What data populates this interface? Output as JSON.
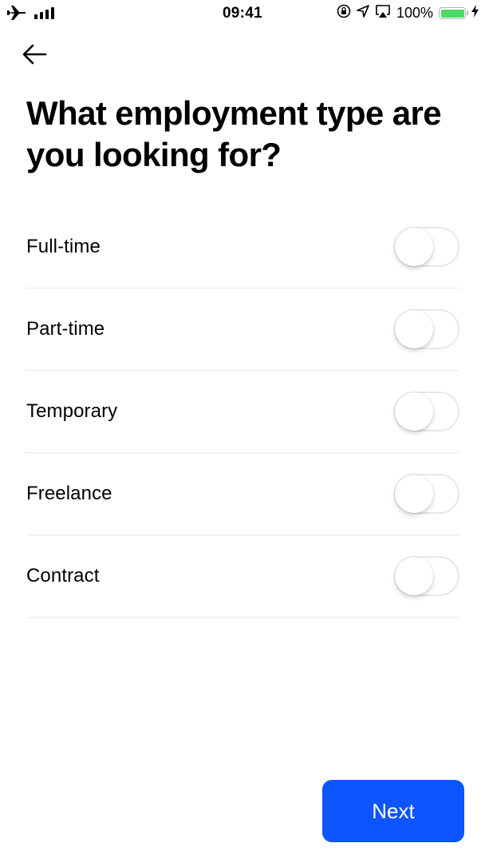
{
  "status_bar": {
    "time": "09:41",
    "battery_percent": "100%",
    "battery_level": 1.0,
    "icons_left": [
      "airplane-icon",
      "signal-icon"
    ],
    "icons_right": [
      "rotation-lock-icon",
      "location-icon",
      "airplay-icon",
      "battery-icon",
      "charging-icon"
    ]
  },
  "header": {
    "back_icon": "arrow-left-icon",
    "title": "What employment type are you looking for?"
  },
  "options": [
    {
      "label": "Full-time",
      "enabled": false
    },
    {
      "label": "Part-time",
      "enabled": false
    },
    {
      "label": "Temporary",
      "enabled": false
    },
    {
      "label": "Freelance",
      "enabled": false
    },
    {
      "label": "Contract",
      "enabled": false
    }
  ],
  "footer": {
    "next_label": "Next"
  },
  "colors": {
    "accent": "#0d55ff",
    "battery": "#4cd964",
    "divider": "#e9e9ec"
  }
}
